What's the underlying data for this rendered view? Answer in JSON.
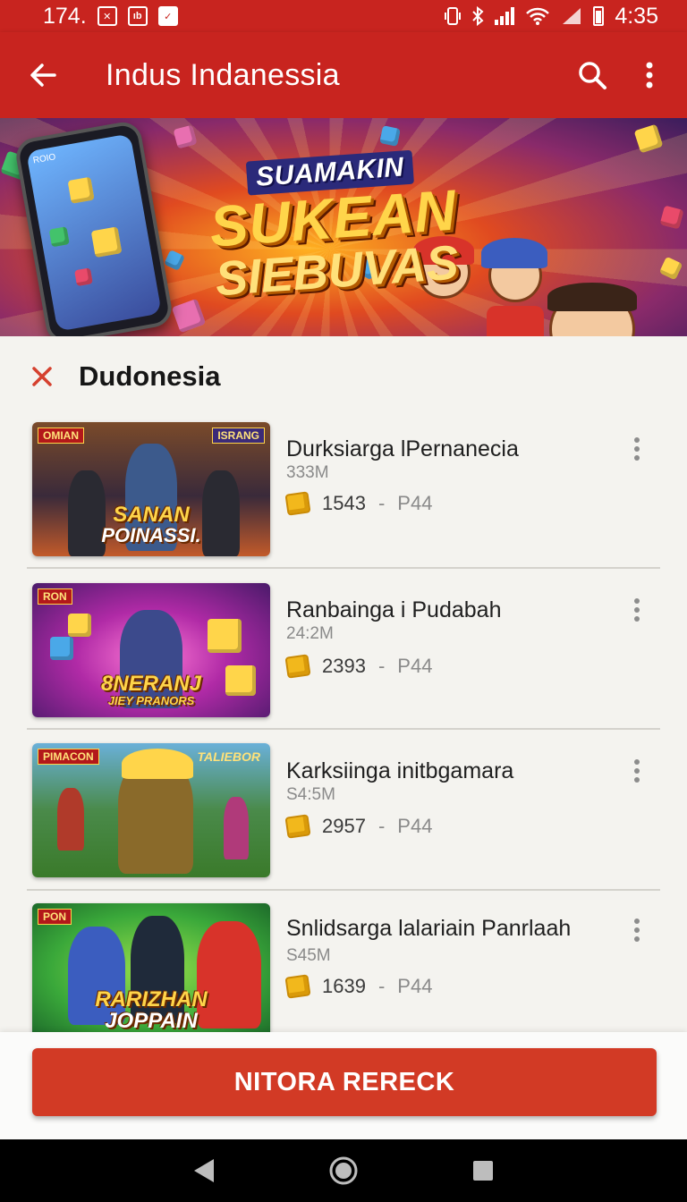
{
  "status_bar": {
    "left_text": "174.",
    "icons": [
      "sim-card-icon",
      "notification-icon",
      "mail-icon"
    ],
    "right_icons": [
      "vibrate-icon",
      "bluetooth-icon",
      "signal-icon",
      "wifi-icon",
      "battery-icon"
    ],
    "time": "4:35"
  },
  "app_bar": {
    "title": "Indus Indanessia",
    "back_icon": "arrow-left-icon",
    "search_icon": "search-icon",
    "more_icon": "more-vert-icon"
  },
  "banner": {
    "small_text": "SUAMAKIN",
    "big_text_line1": "SUKEAN",
    "big_text_line2": "SIEBUVAS",
    "phone_label": "ROIO"
  },
  "section": {
    "title": "Dudonesia",
    "close_icon": "close-icon"
  },
  "items": [
    {
      "title": "Durksiarga lPernanecia",
      "size": "333M",
      "count": "1543",
      "separator": "-",
      "version": "P44",
      "thumb_tag": "OMIAN",
      "thumb_tag2": "ISRANG",
      "thumb_line1": "SANAN",
      "thumb_line2": "POINASSI."
    },
    {
      "title": "Ranbainga i Pudabah",
      "size": "24:2M",
      "count": "2393",
      "separator": "-",
      "version": "P44",
      "thumb_tag": "RON",
      "thumb_tag2": "",
      "thumb_line1": "8NERANJ",
      "thumb_line2": "JIEY PRANORS"
    },
    {
      "title": "Karksiinga initbgamara",
      "size": "S4:5M",
      "count": "2957",
      "separator": "-",
      "version": "P44",
      "thumb_tag": "PIMACON",
      "thumb_tag2": "TALIEBOR",
      "thumb_line1": "",
      "thumb_line2": ""
    },
    {
      "title": "Snlidsarga lalariain Panrlaah",
      "size": "S45M",
      "count": "1639",
      "separator": "-",
      "version": "P44",
      "thumb_tag": "PON",
      "thumb_tag2": "",
      "thumb_line1": "RARIZHAN",
      "thumb_line2": "JOPPAIN"
    }
  ],
  "cta": {
    "label": "NITORA RERECK"
  },
  "nav_bar": {
    "back": "nav-back-icon",
    "home": "nav-home-icon",
    "recents": "nav-recents-icon"
  },
  "colors": {
    "primary": "#c8241f",
    "cta": "#d23a25",
    "coin": "#f2b81c"
  }
}
